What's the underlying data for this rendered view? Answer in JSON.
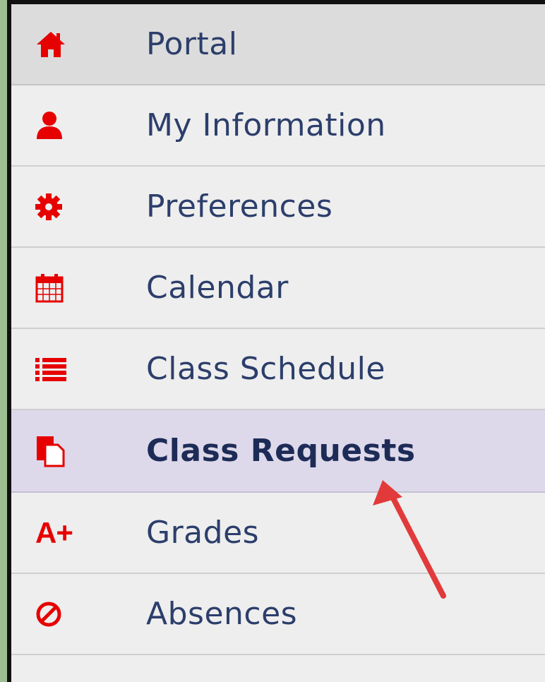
{
  "menu": {
    "items": [
      {
        "label": "Portal",
        "icon": "home-icon"
      },
      {
        "label": "My Information",
        "icon": "user-icon"
      },
      {
        "label": "Preferences",
        "icon": "gear-icon"
      },
      {
        "label": "Calendar",
        "icon": "calendar-icon"
      },
      {
        "label": "Class Schedule",
        "icon": "list-icon"
      },
      {
        "label": "Class Requests",
        "icon": "documents-icon",
        "active": true
      },
      {
        "label": "Grades",
        "icon": "grades-icon",
        "glyph": "A+"
      },
      {
        "label": "Absences",
        "icon": "ban-icon"
      }
    ]
  },
  "colors": {
    "accent": "#e60000",
    "label_text": "#2c3e6b",
    "active_bg": "#ddd9ea",
    "annotation_arrow": "#e23a3a"
  }
}
